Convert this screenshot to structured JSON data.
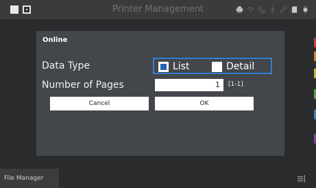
{
  "topbar": {
    "title": "Printer Management",
    "icons": [
      "square-filled-icon",
      "square-outline-icon",
      "printer-icon",
      "wifi-icon",
      "network-icon",
      "usb-icon",
      "connection-icon",
      "sdcard-icon",
      "power-plug-icon"
    ]
  },
  "dialog": {
    "title": "Online",
    "data_type_label": "Data Type",
    "option_list": "List",
    "option_detail": "Detail",
    "selected": "List",
    "pages_label": "Number of Pages",
    "pages_value": "1",
    "pages_range": "[1-1]",
    "cancel_label": "Cancel",
    "ok_label": "OK"
  },
  "bottombar": {
    "tab_label": "File Manager",
    "menu_icon": "menu-icon"
  },
  "colors": {
    "accent": "#2e7fd0",
    "selected_fill": "#1f63b8",
    "dialog_bg": "#43464a"
  }
}
